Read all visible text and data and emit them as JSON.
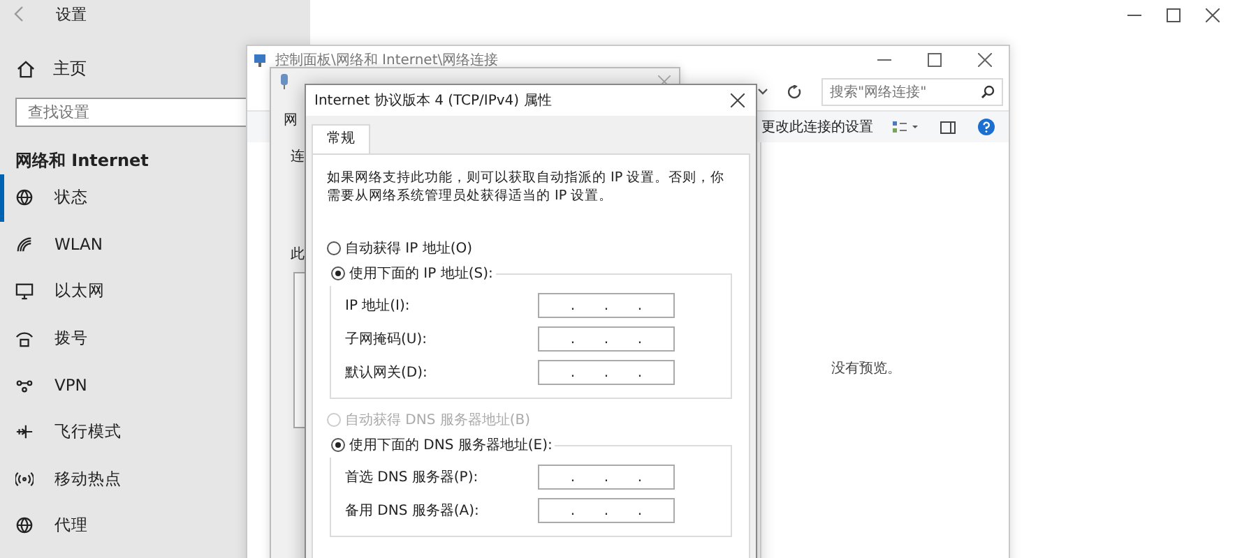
{
  "settings": {
    "title": "设置",
    "home": "主页",
    "search": {
      "placeholder": "查找设置"
    },
    "section": "网络和 Internet",
    "nav": [
      {
        "label": "状态",
        "selected": true
      },
      {
        "label": "WLAN",
        "selected": false
      },
      {
        "label": "以太网",
        "selected": false
      },
      {
        "label": "拨号",
        "selected": false
      },
      {
        "label": "VPN",
        "selected": false
      },
      {
        "label": "飞行模式",
        "selected": false
      },
      {
        "label": "移动热点",
        "selected": false
      },
      {
        "label": "代理",
        "selected": false
      }
    ]
  },
  "control_panel": {
    "title": "控制面板\\网络和 Internet\\网络连接",
    "search": {
      "placeholder": "搜索\"网络连接\""
    },
    "toolbar_link": "更改此连接的设置",
    "preview": "没有预览。"
  },
  "ethernet": {
    "tab": "网",
    "labels": [
      "连",
      "此"
    ]
  },
  "ipv4": {
    "title": "Internet 协议版本 4 (TCP/IPv4) 属性",
    "tabs": [
      {
        "label": "常规",
        "selected": true
      }
    ],
    "description": "如果网络支持此功能，则可以获取自动指派的 IP 设置。否则，你需要从网络系统管理员处获得适当的 IP 设置。",
    "ip_options": [
      {
        "label": "自动获得 IP 地址(O)",
        "selected": false,
        "disabled": false
      },
      {
        "label": "使用下面的 IP 地址(S):",
        "selected": true,
        "disabled": false
      }
    ],
    "ip_fields": [
      {
        "label": "IP 地址(I):",
        "dots": [
          ".",
          ".",
          "."
        ]
      },
      {
        "label": "子网掩码(U):",
        "dots": [
          ".",
          ".",
          "."
        ]
      },
      {
        "label": "默认网关(D):",
        "dots": [
          ".",
          ".",
          "."
        ]
      }
    ],
    "dns_options": [
      {
        "label": "自动获得 DNS 服务器地址(B)",
        "selected": false,
        "disabled": true
      },
      {
        "label": "使用下面的 DNS 服务器地址(E):",
        "selected": true,
        "disabled": false
      }
    ],
    "dns_fields": [
      {
        "label": "首选 DNS 服务器(P):",
        "dots": [
          ".",
          ".",
          "."
        ]
      },
      {
        "label": "备用 DNS 服务器(A):",
        "dots": [
          ".",
          ".",
          "."
        ]
      }
    ]
  }
}
